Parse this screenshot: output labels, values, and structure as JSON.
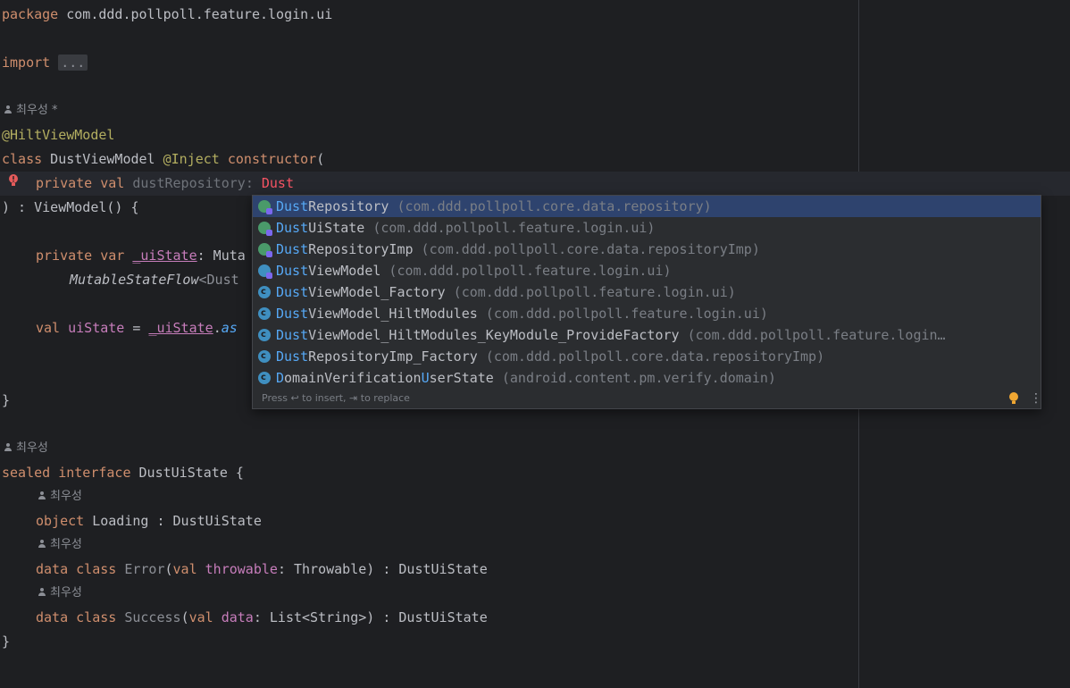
{
  "code": {
    "l1_kw": "package",
    "l1_pkg": " com.ddd.pollpoll.feature.login.ui",
    "l3_kw": "import",
    "l3_fold": "...",
    "author_1": "최우성 *",
    "l6_ann": "@HiltViewModel",
    "l7_kw": "class",
    "l7_name": " DustViewModel ",
    "l7_ann": "@Inject",
    "l7_ctor": " constructor",
    "l7_paren": "(",
    "l8_kw": "private val",
    "l8_prop": " dustRepository",
    "l8_colon": ": ",
    "l8_err": "Dust",
    "l9": ") : ViewModel() {",
    "l11_kw": "private var",
    "l11_prop": "_uiState",
    "l11_rest": ": Muta",
    "l12_it": "MutableStateFlow",
    "l12_rest": "<Dust",
    "l14_kw": "val",
    "l14_prop": " uiState",
    "l14_eq": " = ",
    "l14_prop2": "_uiState",
    "l14_dot": ".",
    "l14_fn": "as",
    "l17": "}",
    "author_2": "최우성",
    "l19_kw": "sealed interface",
    "l19_rest": " DustUiState {",
    "author_3": "최우성",
    "l21_kw": "object",
    "l21_rest": " Loading : DustUiState",
    "author_4": "최우성",
    "l23_kw": "data class",
    "l23_name": " Error",
    "l23_p1": "(",
    "l23_kw2": "val",
    "l23_prop": " throwable",
    "l23_rest": ": Throwable) : DustUiState",
    "author_5": "최우성",
    "l25_kw": "data class",
    "l25_name": " Success",
    "l25_p1": "(",
    "l25_kw2": "val",
    "l25_prop": " data",
    "l25_rest": ": List<String>) : DustUiState",
    "l26": "}"
  },
  "completion": {
    "items": [
      {
        "hl1": "Dust",
        "a": "Repository",
        "hl2": "",
        "b": "",
        "pkg": " (com.ddd.pollpoll.core.data.repository)"
      },
      {
        "hl1": "Dust",
        "a": "UiState",
        "hl2": "",
        "b": "",
        "pkg": " (com.ddd.pollpoll.feature.login.ui)"
      },
      {
        "hl1": "Dust",
        "a": "RepositoryImp",
        "hl2": "",
        "b": "",
        "pkg": " (com.ddd.pollpoll.core.data.repositoryImp)"
      },
      {
        "hl1": "Dust",
        "a": "ViewModel",
        "hl2": "",
        "b": "",
        "pkg": " (com.ddd.pollpoll.feature.login.ui)"
      },
      {
        "hl1": "Dust",
        "a": "ViewModel_Factory",
        "hl2": "",
        "b": "",
        "pkg": " (com.ddd.pollpoll.feature.login.ui)"
      },
      {
        "hl1": "Dust",
        "a": "ViewModel_HiltModules",
        "hl2": "",
        "b": "",
        "pkg": " (com.ddd.pollpoll.feature.login.ui)"
      },
      {
        "hl1": "Dust",
        "a": "ViewModel_HiltModules_KeyModule_ProvideFactory",
        "hl2": "",
        "b": "",
        "pkg": " (com.ddd.pollpoll.feature.login…"
      },
      {
        "hl1": "Dust",
        "a": "RepositoryImp_Factory",
        "hl2": "",
        "b": "",
        "pkg": " (com.ddd.pollpoll.core.data.repositoryImp)"
      },
      {
        "hl1": "D",
        "a": "omainVerification",
        "hl2": "U",
        "b": "serSt",
        "hl3": "",
        "pkg": " (android.content.pm.verify.domain)",
        "c": "ate",
        "dtype": true
      }
    ],
    "footer": "Press ↩ to insert, ⇥ to replace",
    "colors": {
      "selected": "#2e436e",
      "highlight": "#56a8f5"
    }
  }
}
